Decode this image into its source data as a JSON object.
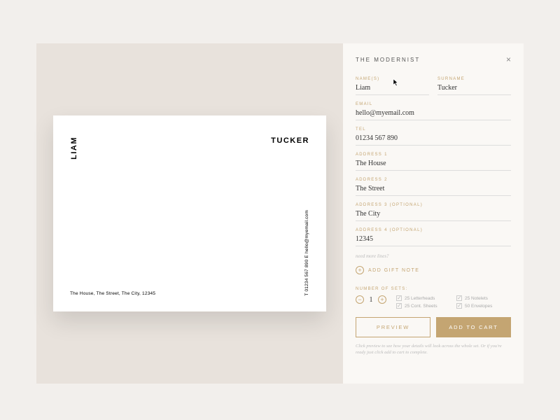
{
  "product_title": "THE MODERNIST",
  "preview": {
    "first_name": "LIAM",
    "surname": "TUCKER",
    "address_line": "The House, The Street, The City, 12345",
    "contact_line": "T 01234 567 890   E hello@myemail.com"
  },
  "form": {
    "names_label": "NAME(S)",
    "names_value": "Liam",
    "surname_label": "SURNAME",
    "surname_value": "Tucker",
    "email_label": "EMAIL",
    "email_value": "hello@myemail.com",
    "tel_label": "TEL",
    "tel_value": "01234 567 890",
    "addr1_label": "ADDRESS 1",
    "addr1_value": "The House",
    "addr2_label": "ADDRESS 2",
    "addr2_value": "The Street",
    "addr3_label": "ADDRESS 3 (OPTIONAL)",
    "addr3_value": "The City",
    "addr4_label": "ADDRESS 4 (OPTIONAL)",
    "addr4_value": "12345",
    "more_lines_hint": "need more lines?",
    "gift_note_label": "ADD GIFT NOTE",
    "sets_label": "NUMBER OF SETS:",
    "sets_value": "1",
    "includes": [
      "25 Letterheads",
      "25 Notelets",
      "25 Cont. Sheets",
      "50 Envelopes"
    ],
    "preview_btn": "PREVIEW",
    "add_btn": "ADD TO CART",
    "footnote": "Click preview to see how your details will look across the whole set. Or if you're ready just click add to cart to complete."
  }
}
